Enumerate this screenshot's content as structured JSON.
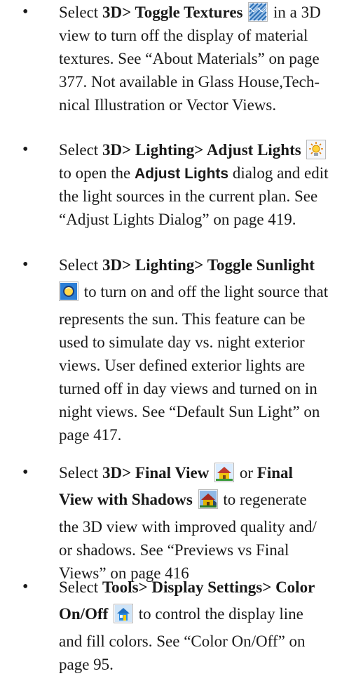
{
  "items": [
    {
      "lines": [
        [
          "Select ",
          "3D> Toggle Textures",
          " in a 3D"
        ],
        "view to turn off the display of material",
        "textures. See “About Materials” on page",
        "377. Not available in Glass House,Tech-",
        "nical Illustration or Vector Views."
      ]
    },
    {
      "lines": [
        [
          "Select ",
          "3D> Lighting> Adjust Lights"
        ],
        [
          "to open the ",
          "Adjust Lights",
          " dialog and edit"
        ],
        "the light sources in the current plan. See",
        "“Adjust Lights Dialog” on page 419."
      ]
    },
    {
      "lines": [
        [
          "Select ",
          "3D> Lighting> Toggle Sunlight"
        ],
        " to turn on and off the light source that",
        "represents the sun. This feature can be",
        "used to simulate day vs. night exterior",
        "views. User defined exterior lights are",
        "turned off in day views and turned on in",
        "night views. See “Default Sun Light” on",
        "page 417."
      ]
    },
    {
      "lines": [
        [
          "Select ",
          "3D> Final View",
          " or ",
          "Final"
        ],
        [
          "View with Shadows",
          " to regenerate"
        ],
        "the 3D view with improved quality and/",
        "or shadows. See “Previews vs Final",
        "Views” on page 416"
      ]
    },
    {
      "lines": [
        [
          "Select ",
          "Tools> Display Settings> Color"
        ],
        [
          "On/Off",
          " to control the display line"
        ],
        "and fill colors. See “Color On/Off” on",
        "page 95."
      ]
    }
  ],
  "bullet": "•",
  "icons": [
    "toggle-textures-icon",
    "adjust-lights-icon",
    "toggle-sunlight-icon",
    "final-view-icon",
    "final-view-shadows-icon",
    "color-on-off-icon"
  ]
}
